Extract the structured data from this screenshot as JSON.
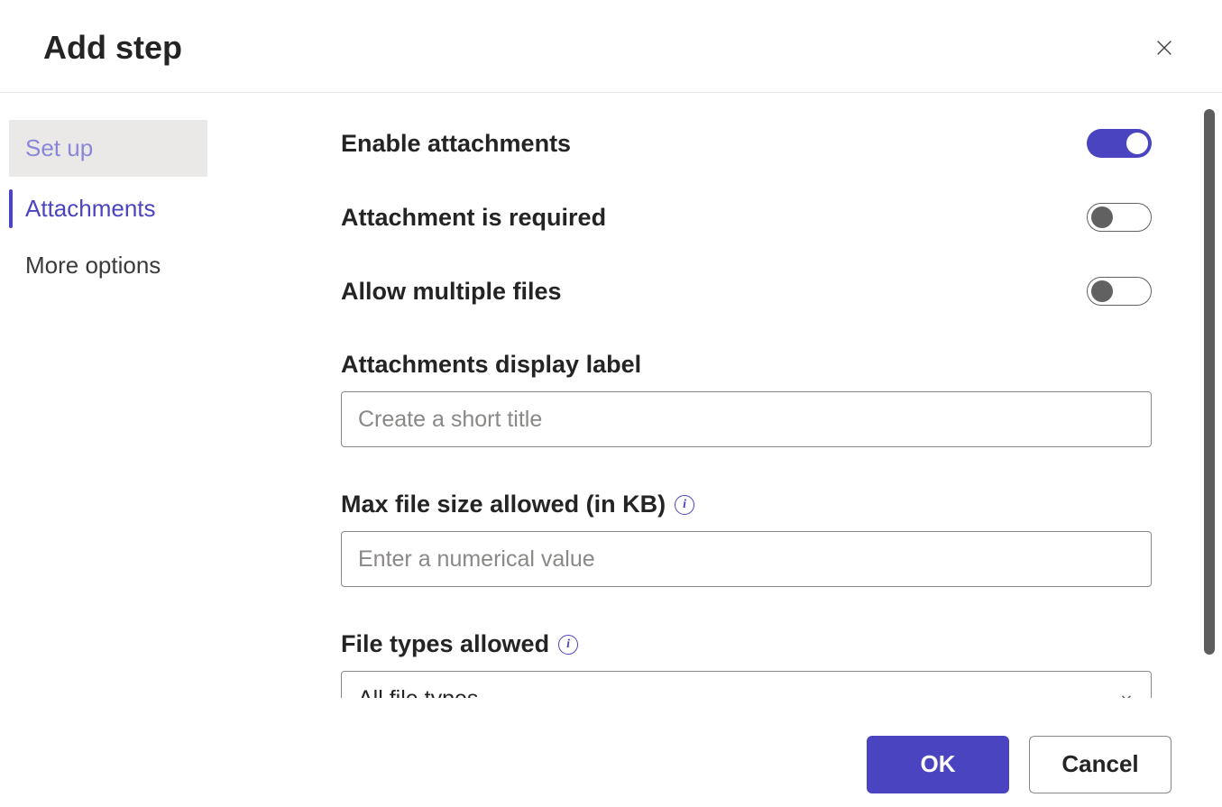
{
  "header": {
    "title": "Add step"
  },
  "sidebar": {
    "items": [
      {
        "label": "Set up",
        "state": "visited"
      },
      {
        "label": "Attachments",
        "state": "active"
      },
      {
        "label": "More options",
        "state": "default"
      }
    ]
  },
  "main": {
    "toggles": [
      {
        "label": "Enable attachments",
        "on": true
      },
      {
        "label": "Attachment is required",
        "on": false
      },
      {
        "label": "Allow multiple files",
        "on": false
      }
    ],
    "display_label_field": {
      "label": "Attachments display label",
      "placeholder": "Create a short title",
      "value": ""
    },
    "max_size_field": {
      "label": "Max file size allowed (in KB)",
      "placeholder": "Enter a numerical value",
      "value": ""
    },
    "file_types_field": {
      "label": "File types allowed",
      "selected": "All file types"
    }
  },
  "footer": {
    "ok": "OK",
    "cancel": "Cancel"
  }
}
